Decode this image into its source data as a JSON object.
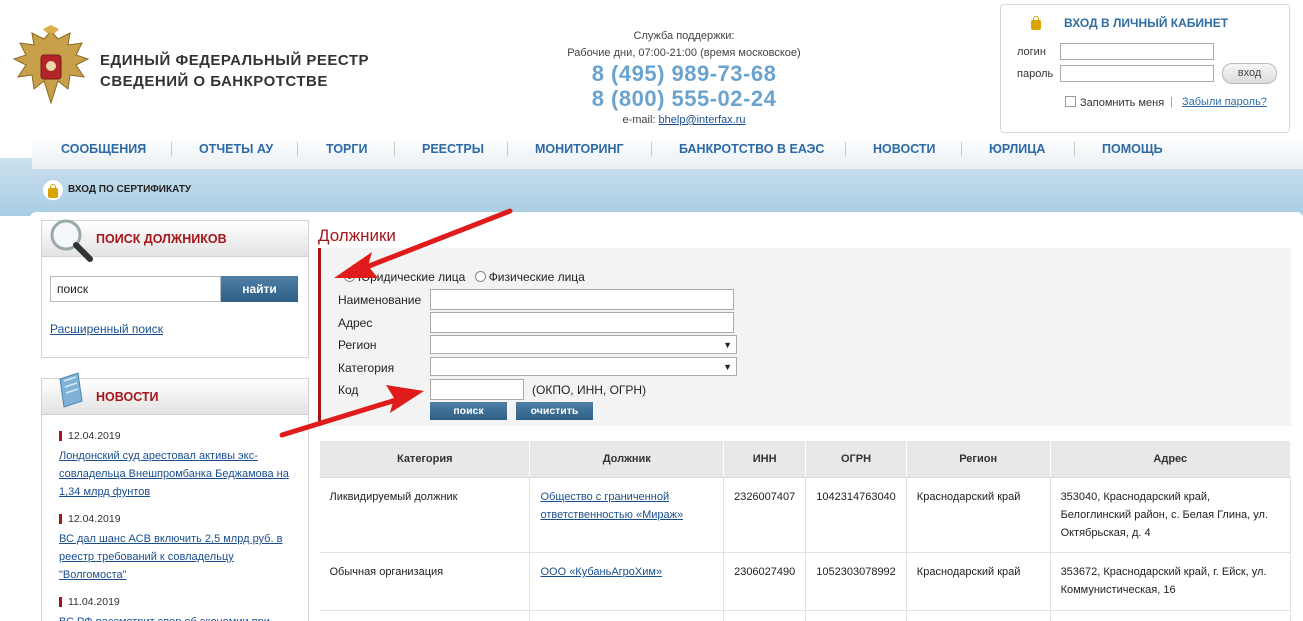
{
  "header": {
    "title_line1": "ЕДИНЫЙ ФЕДЕРАЛЬНЫЙ РЕЕСТР",
    "title_line2": "СВЕДЕНИЙ О БАНКРОТСТВЕ",
    "support_label": "Служба поддержки:",
    "support_hours": "Рабочие дни, 07:00-21:00 (время московское)",
    "phone1": "8 (495) 989-73-68",
    "phone2": "8 (800) 555-02-24",
    "email_prefix": "e-mail:",
    "email": "bhelp@interfax.ru"
  },
  "login": {
    "title": "ВХОД В ЛИЧНЫЙ КАБИНЕТ",
    "login_label": "логин",
    "password_label": "пароль",
    "button": "вход",
    "remember": "Запомнить меня",
    "separator": "|",
    "forgot": "Забыли пароль?"
  },
  "nav": {
    "items": [
      "СООБЩЕНИЯ",
      "ОТЧЕТЫ АУ",
      "ТОРГИ",
      "РЕЕСТРЫ",
      "МОНИТОРИНГ",
      "БАНКРОТСТВО В ЕАЭС",
      "НОВОСТИ",
      "ЮРЛИЦА",
      "ПОМОЩЬ"
    ]
  },
  "cert": {
    "label": "ВХОД ПО СЕРТИФИКАТУ"
  },
  "sidebar": {
    "search_title": "ПОИСК ДОЛЖНИКОВ",
    "search_value": "поиск",
    "search_button": "найти",
    "advanced": "Расширенный поиск",
    "news_title": "НОВОСТИ",
    "news": [
      {
        "date": "12.04.2019",
        "text": "Лондонский суд арестовал активы экс-совладельца Внешпромбанка Беджамова на 1,34 млрд фунтов"
      },
      {
        "date": "12.04.2019",
        "text": "ВС дал шанс АСВ включить 2,5 млрд руб. в реестр требований к совладельцу \"Волгомоста\""
      },
      {
        "date": "11.04.2019",
        "text": "ВС РФ рассмотрит спор об экономии при"
      }
    ]
  },
  "content": {
    "page_title": "Должники",
    "radio_legal": "Юридические лица",
    "radio_physical": "Физические лица",
    "label_name": "Наименование",
    "label_address": "Адрес",
    "label_region": "Регион",
    "label_category": "Категория",
    "label_code": "Код",
    "code_hint": "(ОКПО, ИНН, ОГРН)",
    "btn_search": "поиск",
    "btn_clear": "очистить"
  },
  "table": {
    "headers": [
      "Категория",
      "Должник",
      "ИНН",
      "ОГРН",
      "Регион",
      "Адрес"
    ],
    "rows": [
      {
        "category": "Ликвидируемый должник",
        "debtor": "Общество с граниченной ответственностью «Мираж»",
        "inn": "2326007407",
        "ogrn": "1042314763040",
        "region": "Краснодарский край",
        "address": "353040, Краснодарский край, Белоглинский район, с. Белая Глина, ул. Октябрьская, д. 4"
      },
      {
        "category": "Обычная организация",
        "debtor": "ООО «КубаньАгроХим»",
        "inn": "2306027490",
        "ogrn": "1052303078992",
        "region": "Краснодарский край",
        "address": "353672, Краснодарский край, г. Ейск, ул. Коммунистическая, 16"
      }
    ]
  },
  "colors": {
    "accent_red": "#a4161a",
    "link_blue": "#1a4f8f",
    "nav_blue": "#2b6aa7",
    "phone_blue": "#6aa3cf",
    "arrow_red": "#e01b1b"
  }
}
